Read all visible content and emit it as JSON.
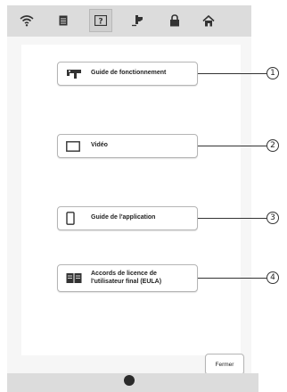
{
  "toolbar": {
    "icons": [
      {
        "name": "wifi-icon",
        "selected": false
      },
      {
        "name": "document-icon",
        "selected": false
      },
      {
        "name": "help-icon",
        "selected": true
      },
      {
        "name": "sewing-icon",
        "selected": false
      },
      {
        "name": "lock-icon",
        "selected": false
      },
      {
        "name": "home-icon",
        "selected": false
      }
    ]
  },
  "menu": {
    "items": [
      {
        "label": "Guide de fonctionnement",
        "icon": "sewing-machine-icon",
        "callout": "1"
      },
      {
        "label": "Vidéo",
        "icon": "video-screen-icon",
        "callout": "2"
      },
      {
        "label": "Guide de l'application",
        "icon": "phone-icon",
        "callout": "3"
      },
      {
        "label": "Accords de licence de\nl'utilisateur final (EULA)",
        "icon": "book-icon",
        "callout": "4"
      }
    ]
  },
  "close_button": {
    "label": "Fermer"
  },
  "colors": {
    "toolbar": "#dcdcdc",
    "screen": "#f6f6f6",
    "text": "#222222"
  }
}
